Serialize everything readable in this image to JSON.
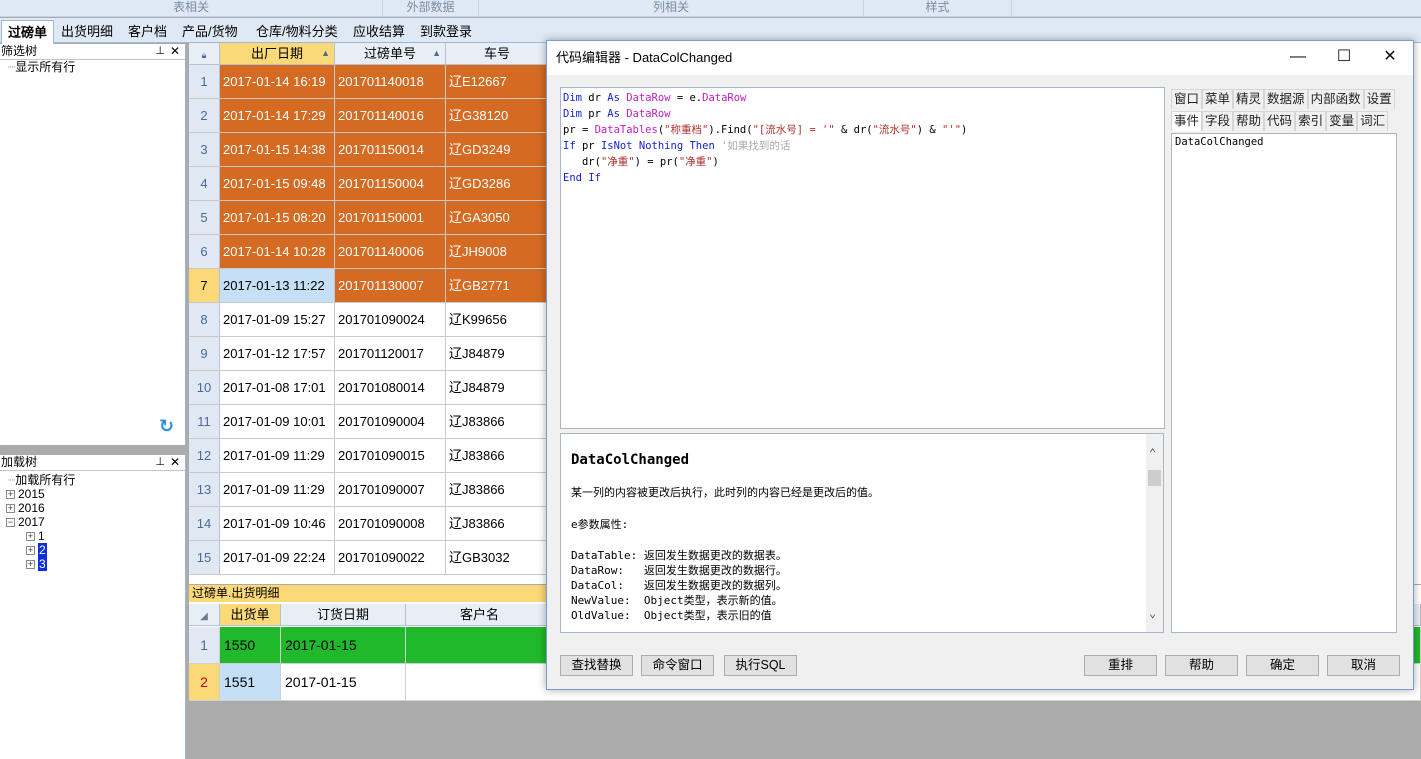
{
  "ribbon_groups": [
    "表相关",
    "外部数据",
    "列相关",
    "样式"
  ],
  "tabs": [
    "过磅单",
    "出货明细",
    "客户档",
    "产品/货物",
    "仓库/物料分类",
    "应收结算",
    "到款登录"
  ],
  "filter_panel": {
    "title": "筛选树",
    "pin": "⊥",
    "close": "✕",
    "root": "显示所有行"
  },
  "load_panel": {
    "title": "加载树",
    "pin": "⊥",
    "close": "✕",
    "root": "加载所有行",
    "years": [
      "2015",
      "2016",
      "2017"
    ],
    "months": [
      "1",
      "2",
      "3"
    ]
  },
  "main_grid": {
    "columns": [
      "出厂日期",
      "过磅单号",
      "车号"
    ],
    "rows": [
      {
        "n": "1",
        "date": "2017-01-14 16:19",
        "no": "201701140018",
        "car": "辽E12667"
      },
      {
        "n": "2",
        "date": "2017-01-14 17:29",
        "no": "201701140016",
        "car": "辽G38120"
      },
      {
        "n": "3",
        "date": "2017-01-15 14:38",
        "no": "201701150014",
        "car": "辽GD3249"
      },
      {
        "n": "4",
        "date": "2017-01-15 09:48",
        "no": "201701150004",
        "car": "辽GD3286"
      },
      {
        "n": "5",
        "date": "2017-01-15 08:20",
        "no": "201701150001",
        "car": "辽GA3050"
      },
      {
        "n": "6",
        "date": "2017-01-14 10:28",
        "no": "201701140006",
        "car": "辽JH9008"
      },
      {
        "n": "7",
        "date": "2017-01-13 11:22",
        "no": "201701130007",
        "car": "辽GB2771"
      },
      {
        "n": "8",
        "date": "2017-01-09 15:27",
        "no": "201701090024",
        "car": "辽K99656"
      },
      {
        "n": "9",
        "date": "2017-01-12 17:57",
        "no": "201701120017",
        "car": "辽J84879"
      },
      {
        "n": "10",
        "date": "2017-01-08 17:01",
        "no": "201701080014",
        "car": "辽J84879"
      },
      {
        "n": "11",
        "date": "2017-01-09 10:01",
        "no": "201701090004",
        "car": "辽J83866"
      },
      {
        "n": "12",
        "date": "2017-01-09 11:29",
        "no": "201701090015",
        "car": "辽J83866"
      },
      {
        "n": "13",
        "date": "2017-01-09 11:29",
        "no": "201701090007",
        "car": "辽J83866"
      },
      {
        "n": "14",
        "date": "2017-01-09 10:46",
        "no": "201701090008",
        "car": "辽J83866"
      },
      {
        "n": "15",
        "date": "2017-01-09 22:24",
        "no": "201701090022",
        "car": "辽GB3032"
      }
    ]
  },
  "sub_grid": {
    "title": "过磅单.出货明细",
    "columns": [
      "出货单",
      "订货日期",
      "客户名"
    ],
    "rows": [
      {
        "n": "1",
        "id": "1550",
        "date": "2017-01-15"
      },
      {
        "n": "2",
        "id": "1551",
        "date": "2017-01-15"
      }
    ]
  },
  "dialog": {
    "title": "代码编辑器 - DataColChanged",
    "minimize": "—",
    "maximize": "☐",
    "close": "✕",
    "code": {
      "l1a": "Dim",
      "l1b": " dr ",
      "l1c": "As",
      "l1d": " ",
      "l1e": "DataRow",
      "l1f": " = e.",
      "l1g": "DataRow",
      "l2a": "Dim",
      "l2b": " pr ",
      "l2c": "As",
      "l2d": " ",
      "l2e": "DataRow",
      "l3a": "pr = ",
      "l3b": "DataTables",
      "l3c": "(",
      "l3d": "\"称重档\"",
      "l3e": ").Find(",
      "l3f": "\"[流水号] = '\"",
      "l3g": " & dr(",
      "l3h": "\"流水号\"",
      "l3i": ") & ",
      "l3j": "\"'\"",
      "l3k": ")",
      "l4a": "If",
      "l4b": " pr ",
      "l4c": "IsNot",
      "l4d": " ",
      "l4e": "Nothing",
      "l4f": " ",
      "l4g": "Then",
      "l4h": " '如果找到的话",
      "l5a": "   dr(",
      "l5b": "\"净重\"",
      "l5c": ") = pr(",
      "l5d": "\"净重\"",
      "l5e": ")",
      "l6a": "End",
      "l6b": " ",
      "l6c": "If"
    },
    "help": {
      "title": "DataColChanged",
      "desc": "某一列的内容被更改后执行，此时列的内容已经是更改后的值。",
      "props_head": "e参数属性:",
      "props": [
        "DataTable: 返回发生数据更改的数据表。",
        "DataRow:   返回发生数据更改的数据行。",
        "DataCol:   返回发生数据更改的数据列。",
        "NewValue:  Object类型，表示新的值。",
        "OldValue:  Object类型，表示旧的值"
      ]
    },
    "side_tabs_row1": [
      "窗口",
      "菜单",
      "精灵",
      "数据源",
      "内部函数",
      "设置"
    ],
    "side_tabs_row2": [
      "事件",
      "字段",
      "帮助",
      "代码",
      "索引",
      "变量",
      "词汇"
    ],
    "side_list": [
      "DataColChanged"
    ],
    "buttons": {
      "find": "查找替换",
      "cmd": "命令窗口",
      "sql": "执行SQL",
      "reorder": "重排",
      "help": "帮助",
      "ok": "确定",
      "cancel": "取消"
    }
  },
  "colors": {
    "orange": "#d56a22",
    "selected": "#c5dff7",
    "green": "#20b92b",
    "header_sort": "#fbd878"
  }
}
